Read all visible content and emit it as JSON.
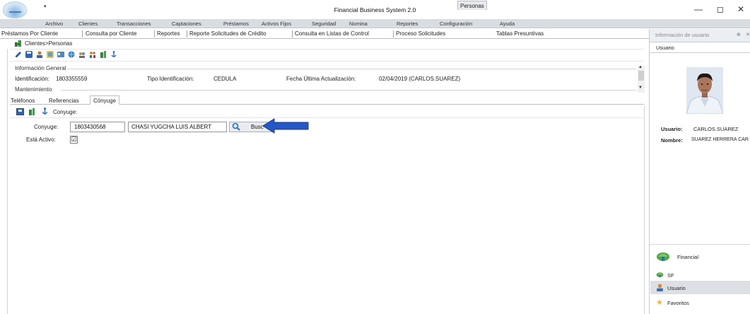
{
  "window": {
    "title": "Financial Business System 2.0",
    "quick_access": "▾",
    "minimize": "—",
    "maximize": "◻",
    "close": "✕"
  },
  "menu": [
    "Archivo",
    "Clientes",
    "Transacciones",
    "Captaciones",
    "Préstamos",
    "Activos Fijos",
    "Seguridad",
    "Nomina",
    "Reportes",
    "Configuración",
    "Ayuda"
  ],
  "tabs": [
    "Préstamos Por Cliente",
    "Consulta por Cliente",
    "Reportes",
    "Reporte Solicitudes de Crédito",
    "Consulta en Listas de Control",
    "Proceso Solicitudes",
    "Personas",
    "Tablas Presuntivas"
  ],
  "active_tab": "Personas",
  "breadcrumb": "Clientes>Personas",
  "general_info": {
    "section_label": "Información General",
    "id_label": "Identificación:",
    "id_value": "1803355559",
    "tipo_label": "Tipo Identificación:",
    "tipo_value": "CEDULA",
    "fecha_label": "Fecha Última Actualización:",
    "fecha_value": "02/04/2019 (CARLOS.SUAREZ)"
  },
  "mantenimiento_label": "Mantenimiento",
  "subtabs": [
    "Teléfonos",
    "Referencias",
    "Cónyuge"
  ],
  "active_subtab": "Cónyuge",
  "inner_toolbar_label": "Conyuge:",
  "form": {
    "conyuge_label": "Conyuge:",
    "conyuge_id": "1803430568",
    "conyuge_name": "CHASI YUGCHA LUIS ALBERT",
    "buscar_label": "Busc",
    "activo_label": "Está Activo:",
    "activo_checked": "☑"
  },
  "right_panel": {
    "title": "Información de usuario",
    "pin": "⊕",
    "close": "✕",
    "tab_label": "Usuario",
    "user_label": "Usuario:",
    "user_value": "CARLOS.SUAREZ",
    "name_label": "Nombre:",
    "name_value": "SUAREZ HERRERA CAR",
    "nav": [
      "Financial",
      "SF",
      "Usuario",
      "Favoritos"
    ]
  },
  "colors": {
    "annotation_arrow": "#2458c6",
    "menu_bg": "#d9dde2",
    "accent_blue": "#2f63b5"
  }
}
